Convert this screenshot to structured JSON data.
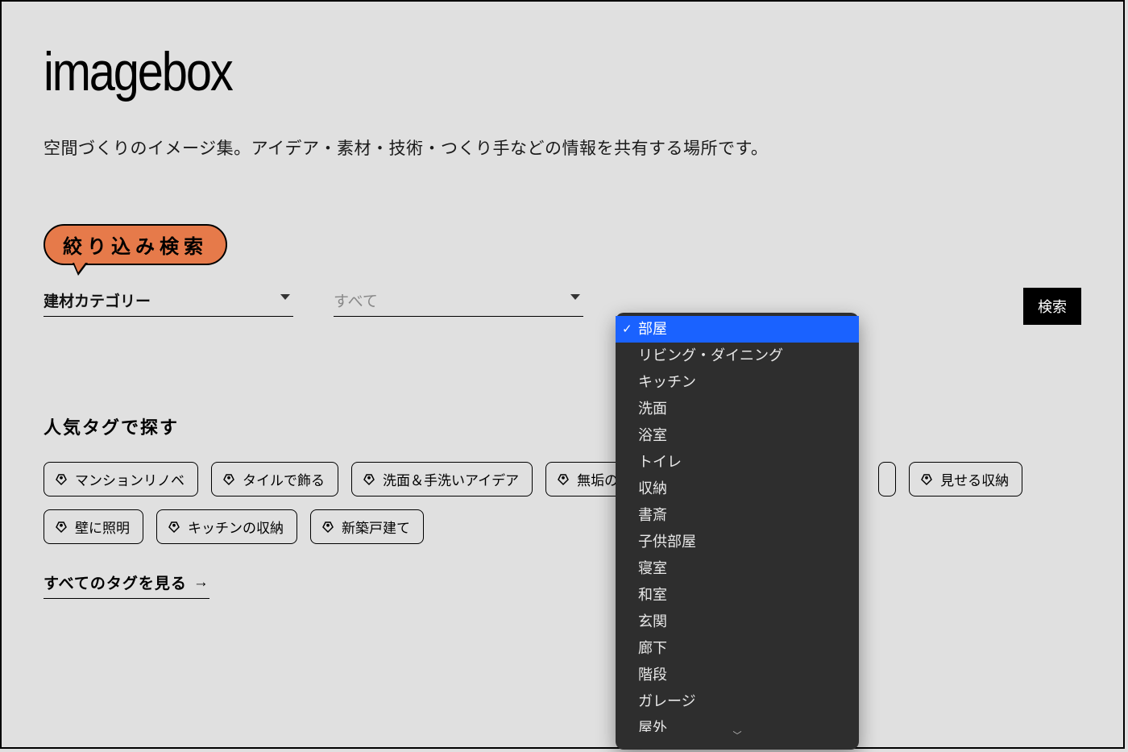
{
  "logo": "imagebox",
  "tagline": "空間づくりのイメージ集。アイデア・素材・技術・つくり手などの情報を共有する場所です。",
  "filter": {
    "badge": "絞り込み検索",
    "select1": "建材カテゴリー",
    "select2": "すべて",
    "search_button": "検索"
  },
  "dropdown": {
    "options": [
      "部屋",
      "リビング・ダイニング",
      "キッチン",
      "洗面",
      "浴室",
      "トイレ",
      "収納",
      "書斎",
      "子供部屋",
      "寝室",
      "和室",
      "玄関",
      "廊下",
      "階段",
      "ガレージ",
      "屋外"
    ],
    "selected_index": 0
  },
  "popular": {
    "heading": "人気タグで探す",
    "tags": [
      "マンションリノベ",
      "タイルで飾る",
      "洗面＆手洗いアイデア",
      "無垢の床",
      "",
      "",
      "",
      "見せる収納",
      "壁に照明",
      "キッチンの収納",
      "新築戸建て"
    ],
    "all_tags_link": "すべてのタグを見る"
  }
}
